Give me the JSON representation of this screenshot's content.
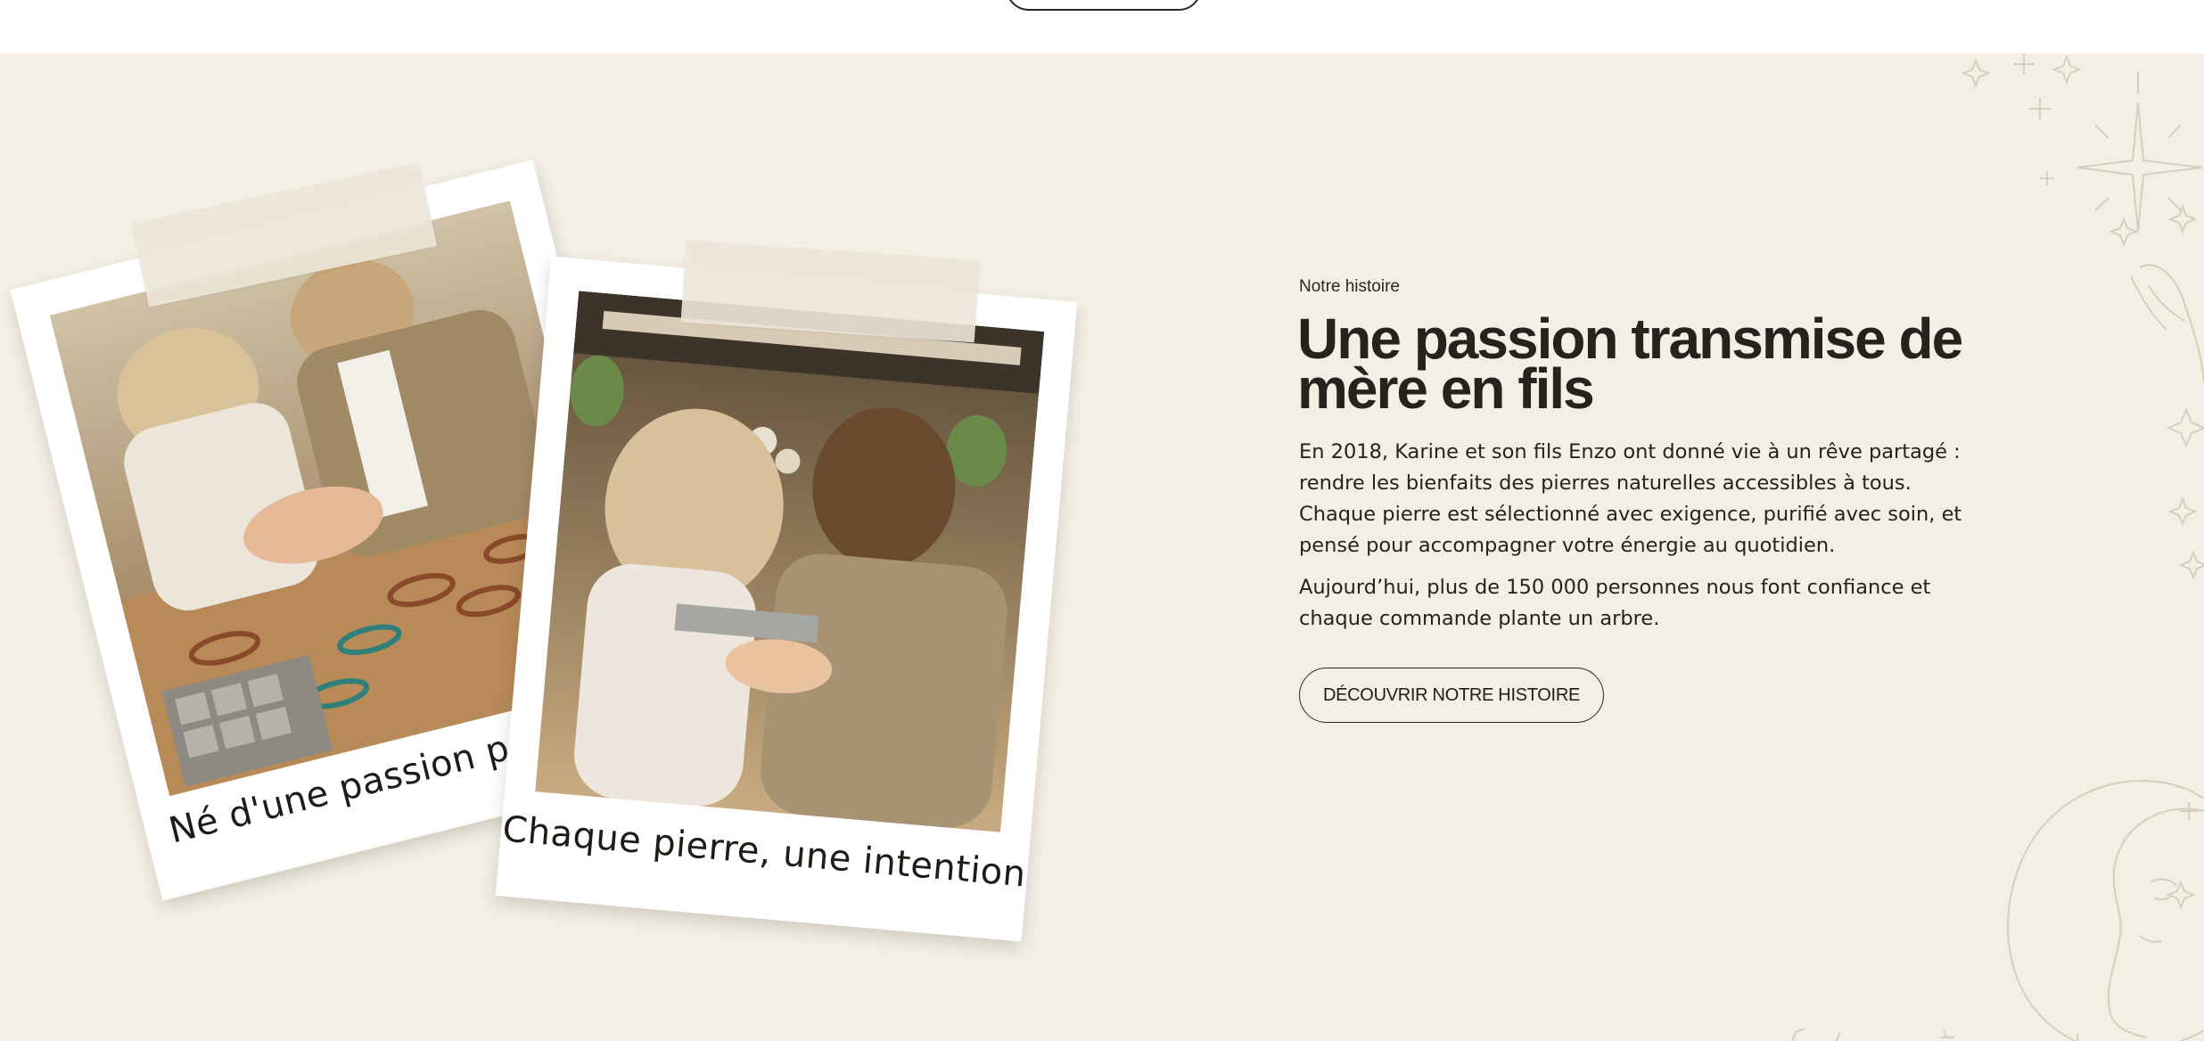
{
  "story": {
    "eyebrow": "Notre histoire",
    "title": "Une passion transmise de mère en fils",
    "paragraph_1": "En 2018, Karine et son fils Enzo ont donné vie à un rêve partagé : rendre les bienfaits des pierres naturelles accessibles à tous. Chaque pierre est sélectionné avec exigence, purifié avec soin, et pensé pour accompagner votre énergie au quotidien.",
    "paragraph_2": "Aujourd’hui, plus de 150 000 personnes nous font confiance et chaque commande plante un arbre.",
    "cta_label": "DÉCOUVRIR NOTRE HISTOIRE"
  },
  "polaroids": [
    {
      "caption": "Né d'une passion partagée",
      "photo_icon": "bracelet-making-photo"
    },
    {
      "caption": "Chaque pierre, une intention",
      "photo_icon": "workshop-photo"
    }
  ],
  "colors": {
    "background": "#f3efe5",
    "text": "#26221e",
    "decoration": "#d8d2c4"
  }
}
